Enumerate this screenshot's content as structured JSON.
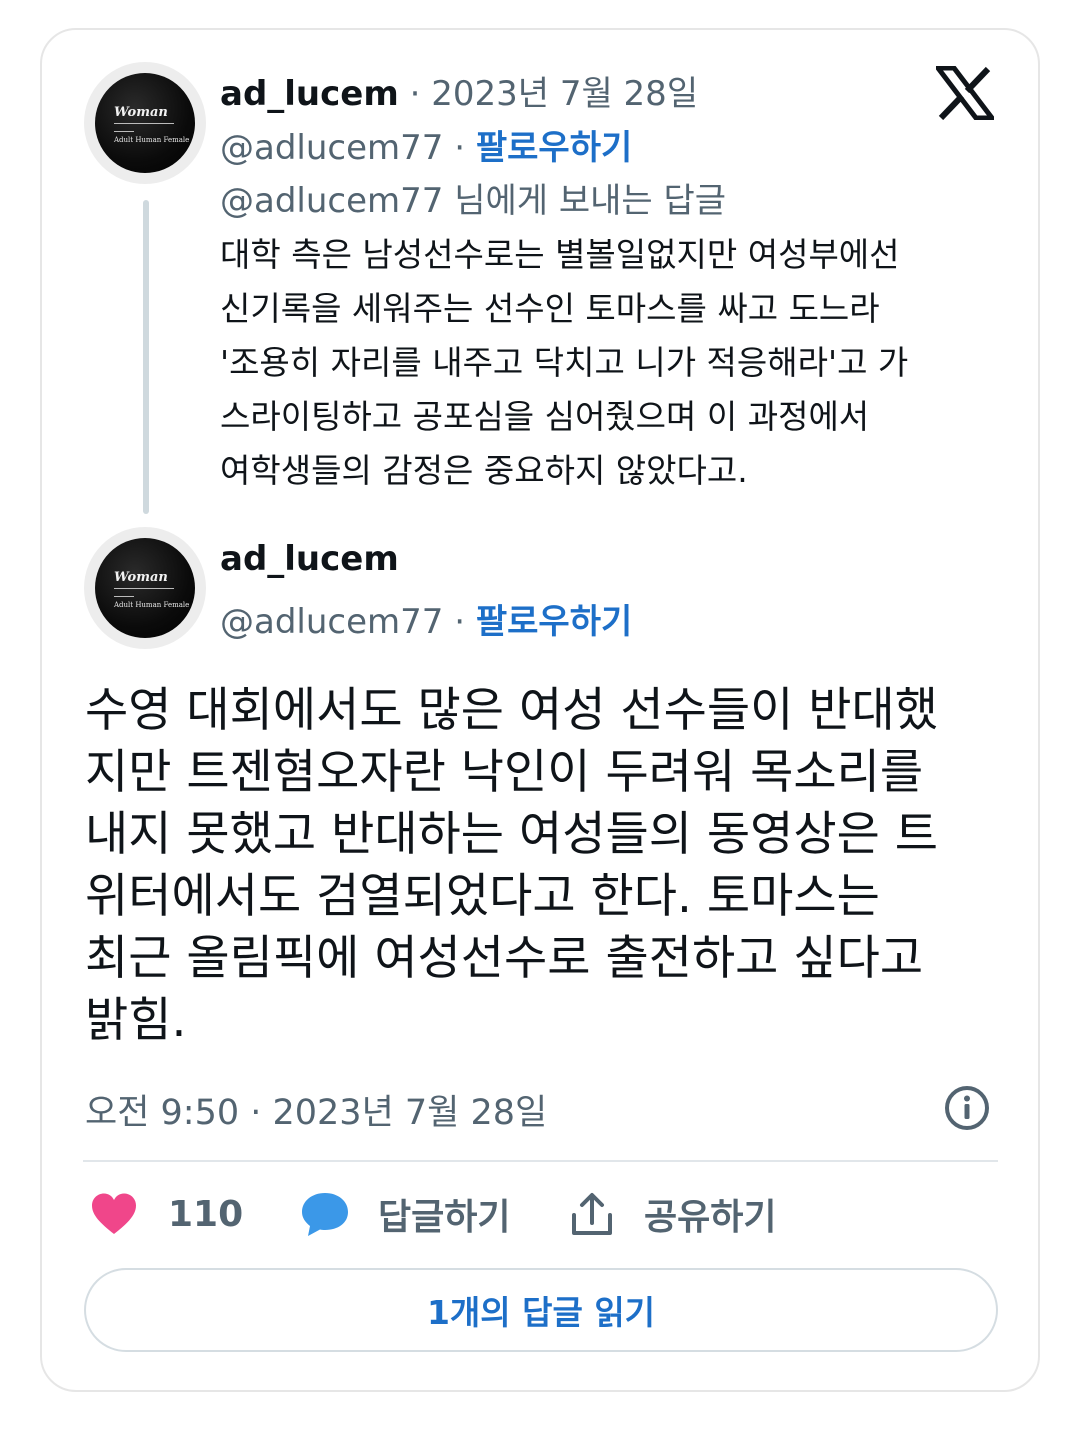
{
  "reply_tweet": {
    "display_name": "ad_lucem",
    "date": " · 2023년 7월 28일",
    "handle": "@adlucem77",
    "separator": " · ",
    "follow_label": "팔로우하기",
    "replying_to": "@adlucem77 님에게 보내는 답글",
    "text": "대학 측은 남성선수로는 별볼일없지만 여성부에선\n신기록을 세워주는 선수인 토마스를 싸고 도느라\n'조용히 자리를 내주고 닥치고 니가 적응해라'고 가\n스라이팅하고 공포심을 심어줬으며 이 과정에서\n여학생들의 감정은 중요하지 않았다고.",
    "avatar": {
      "title": "Woman",
      "subtitle": "Adult Human Female"
    }
  },
  "main_tweet": {
    "display_name": "ad_lucem",
    "handle": "@adlucem77",
    "separator": " · ",
    "follow_label": "팔로우하기",
    "text": "수영 대회에서도 많은 여성 선수들이 반대했\n지만 트젠혐오자란 낙인이 두려워 목소리를\n내지 못했고 반대하는 여성들의 동영상은 트\n위터에서도  검열되었다고 한다. 토마스는\n최근 올림픽에 여성선수로 출전하고 싶다고\n밝힘.",
    "timestamp": "오전 9:50 · 2023년 7월 28일",
    "avatar": {
      "title": "Woman",
      "subtitle": "Adult Human Female"
    }
  },
  "actions": {
    "like_count": "110",
    "reply_label": "답글하기",
    "share_label": "공유하기"
  },
  "read_replies_label": "1개의 답글 읽기",
  "icons": [
    "x-logo-icon",
    "info-icon",
    "heart-icon",
    "reply-bubble-icon",
    "share-icon"
  ],
  "colors": {
    "link_blue": "#1d6fc8",
    "heart": "#f0468a",
    "bubble": "#3b98e8",
    "muted": "#536471"
  }
}
